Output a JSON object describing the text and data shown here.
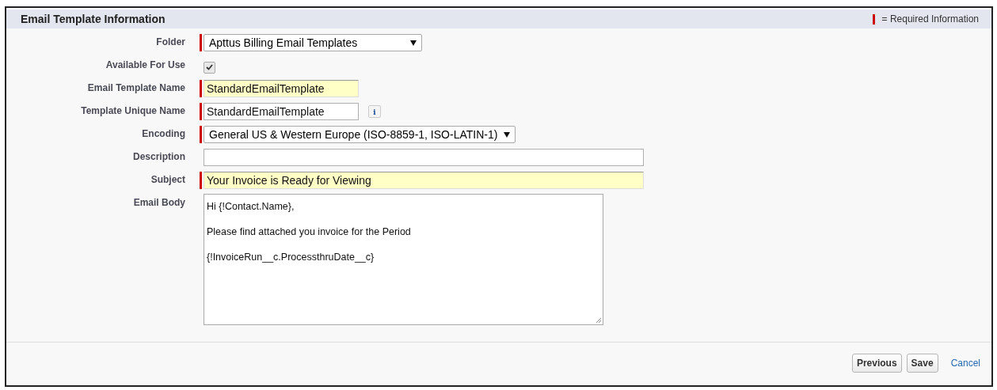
{
  "section": {
    "title": "Email Template Information",
    "legend": "= Required Information"
  },
  "fields": [
    {
      "label": "Folder",
      "kind": "select",
      "required": true,
      "value": "Apttus Billing Email Templates"
    },
    {
      "label": "Available For Use",
      "kind": "checkbox",
      "required": false,
      "checked": true
    },
    {
      "label": "Email Template Name",
      "kind": "text",
      "required": true,
      "highlighted": true,
      "value": "StandardEmailTemplate"
    },
    {
      "label": "Template Unique Name",
      "kind": "text",
      "required": true,
      "highlighted": false,
      "value": "StandardEmailTemplate",
      "info": "i"
    },
    {
      "label": "Encoding",
      "kind": "select",
      "required": true,
      "value": "General US & Western Europe (ISO-8859-1, ISO-LATIN-1)"
    },
    {
      "label": "Description",
      "kind": "text",
      "required": false,
      "highlighted": false
    },
    {
      "label": "Subject",
      "kind": "text",
      "required": true,
      "highlighted": true,
      "value": "Your Invoice is Ready for Viewing"
    },
    {
      "label": "Email Body",
      "kind": "textarea",
      "required": false,
      "value": "Hi {!Contact.Name},\n\nPlease find attached you invoice for the Period\n\n{!InvoiceRun__c.ProcessthruDate__c}"
    }
  ],
  "buttons": [
    {
      "label": "Previous",
      "kind": "button"
    },
    {
      "label": "Save",
      "kind": "button"
    },
    {
      "label": "Cancel",
      "kind": "link"
    }
  ]
}
